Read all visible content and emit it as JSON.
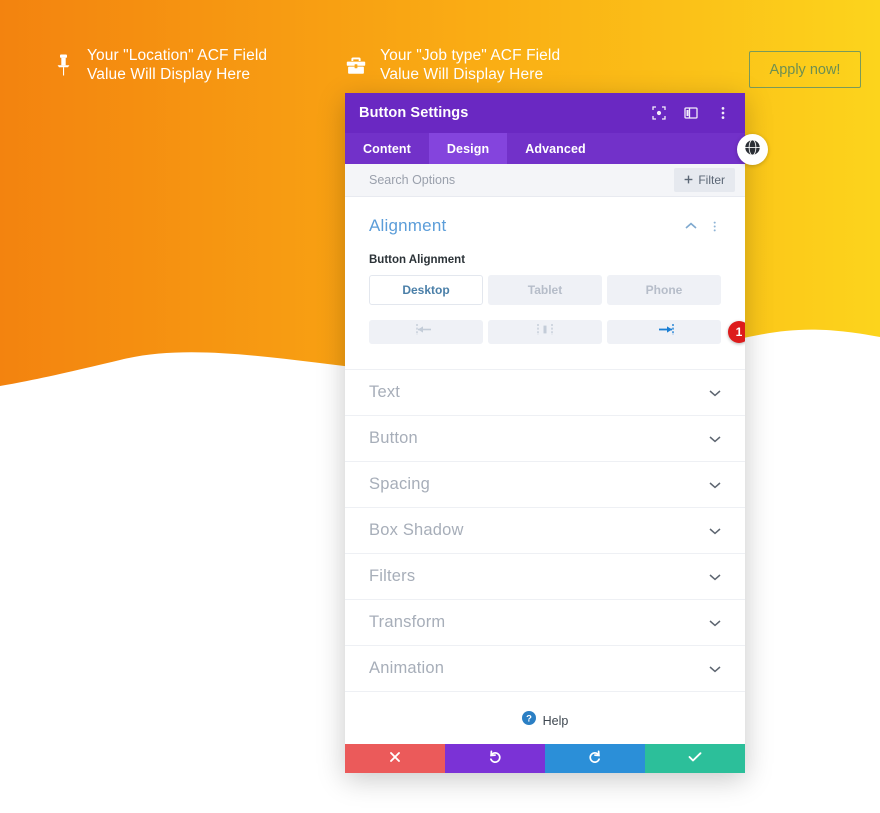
{
  "hero": {
    "gradient_from": "#f38b18",
    "gradient_to": "#fcd41c",
    "wave_fill": "#ffffff",
    "items": [
      {
        "icon": "pin-icon",
        "text": "Your \"Location\" ACF Field\nValue Will Display Here"
      },
      {
        "icon": "briefcase-icon",
        "text": "Your \"Job type\" ACF Field\nValue Will Display Here"
      }
    ],
    "apply_button": {
      "label": "Apply now!",
      "text_color": "#6d8f52",
      "border_color": "#7a9a5a"
    },
    "globe_button": {
      "icon": "globe-icon"
    }
  },
  "modal": {
    "title": "Button Settings",
    "header_color": "#6a28c2",
    "header_icons": [
      {
        "name": "focus-icon"
      },
      {
        "name": "layout-panel-icon"
      },
      {
        "name": "more-vertical-icon"
      }
    ],
    "tabs": [
      {
        "label": "Content",
        "active": false
      },
      {
        "label": "Design",
        "active": true
      },
      {
        "label": "Advanced",
        "active": false
      }
    ],
    "search": {
      "placeholder": "Search Options",
      "value": ""
    },
    "filter_button": {
      "label": "Filter",
      "icon": "plus-icon"
    },
    "alignment_section": {
      "title": "Alignment",
      "title_color": "#5b9dd9",
      "collapse_icon": "chevron-up-icon",
      "menu_icon": "more-vertical-icon",
      "field_label": "Button Alignment",
      "devices": [
        {
          "label": "Desktop",
          "active": true
        },
        {
          "label": "Tablet",
          "active": false
        },
        {
          "label": "Phone",
          "active": false
        }
      ],
      "alignment_options": [
        {
          "name": "align-left-icon",
          "active": false
        },
        {
          "name": "align-center-icon",
          "active": false
        },
        {
          "name": "align-right-icon",
          "active": true
        }
      ],
      "badge": {
        "value": "1",
        "color": "#dd1b1b"
      }
    },
    "sections": [
      {
        "label": "Text"
      },
      {
        "label": "Button"
      },
      {
        "label": "Spacing"
      },
      {
        "label": "Box Shadow"
      },
      {
        "label": "Filters"
      },
      {
        "label": "Transform"
      },
      {
        "label": "Animation"
      }
    ],
    "help": {
      "label": "Help",
      "icon": "question-circle-icon"
    },
    "footer": [
      {
        "name": "cancel-button",
        "icon": "x-icon",
        "color": "#eb5a5a"
      },
      {
        "name": "undo-button",
        "icon": "undo-icon",
        "color": "#7b32d6"
      },
      {
        "name": "redo-button",
        "icon": "redo-icon",
        "color": "#2b8fd8"
      },
      {
        "name": "save-button",
        "icon": "check-icon",
        "color": "#2cbf9a"
      }
    ]
  }
}
